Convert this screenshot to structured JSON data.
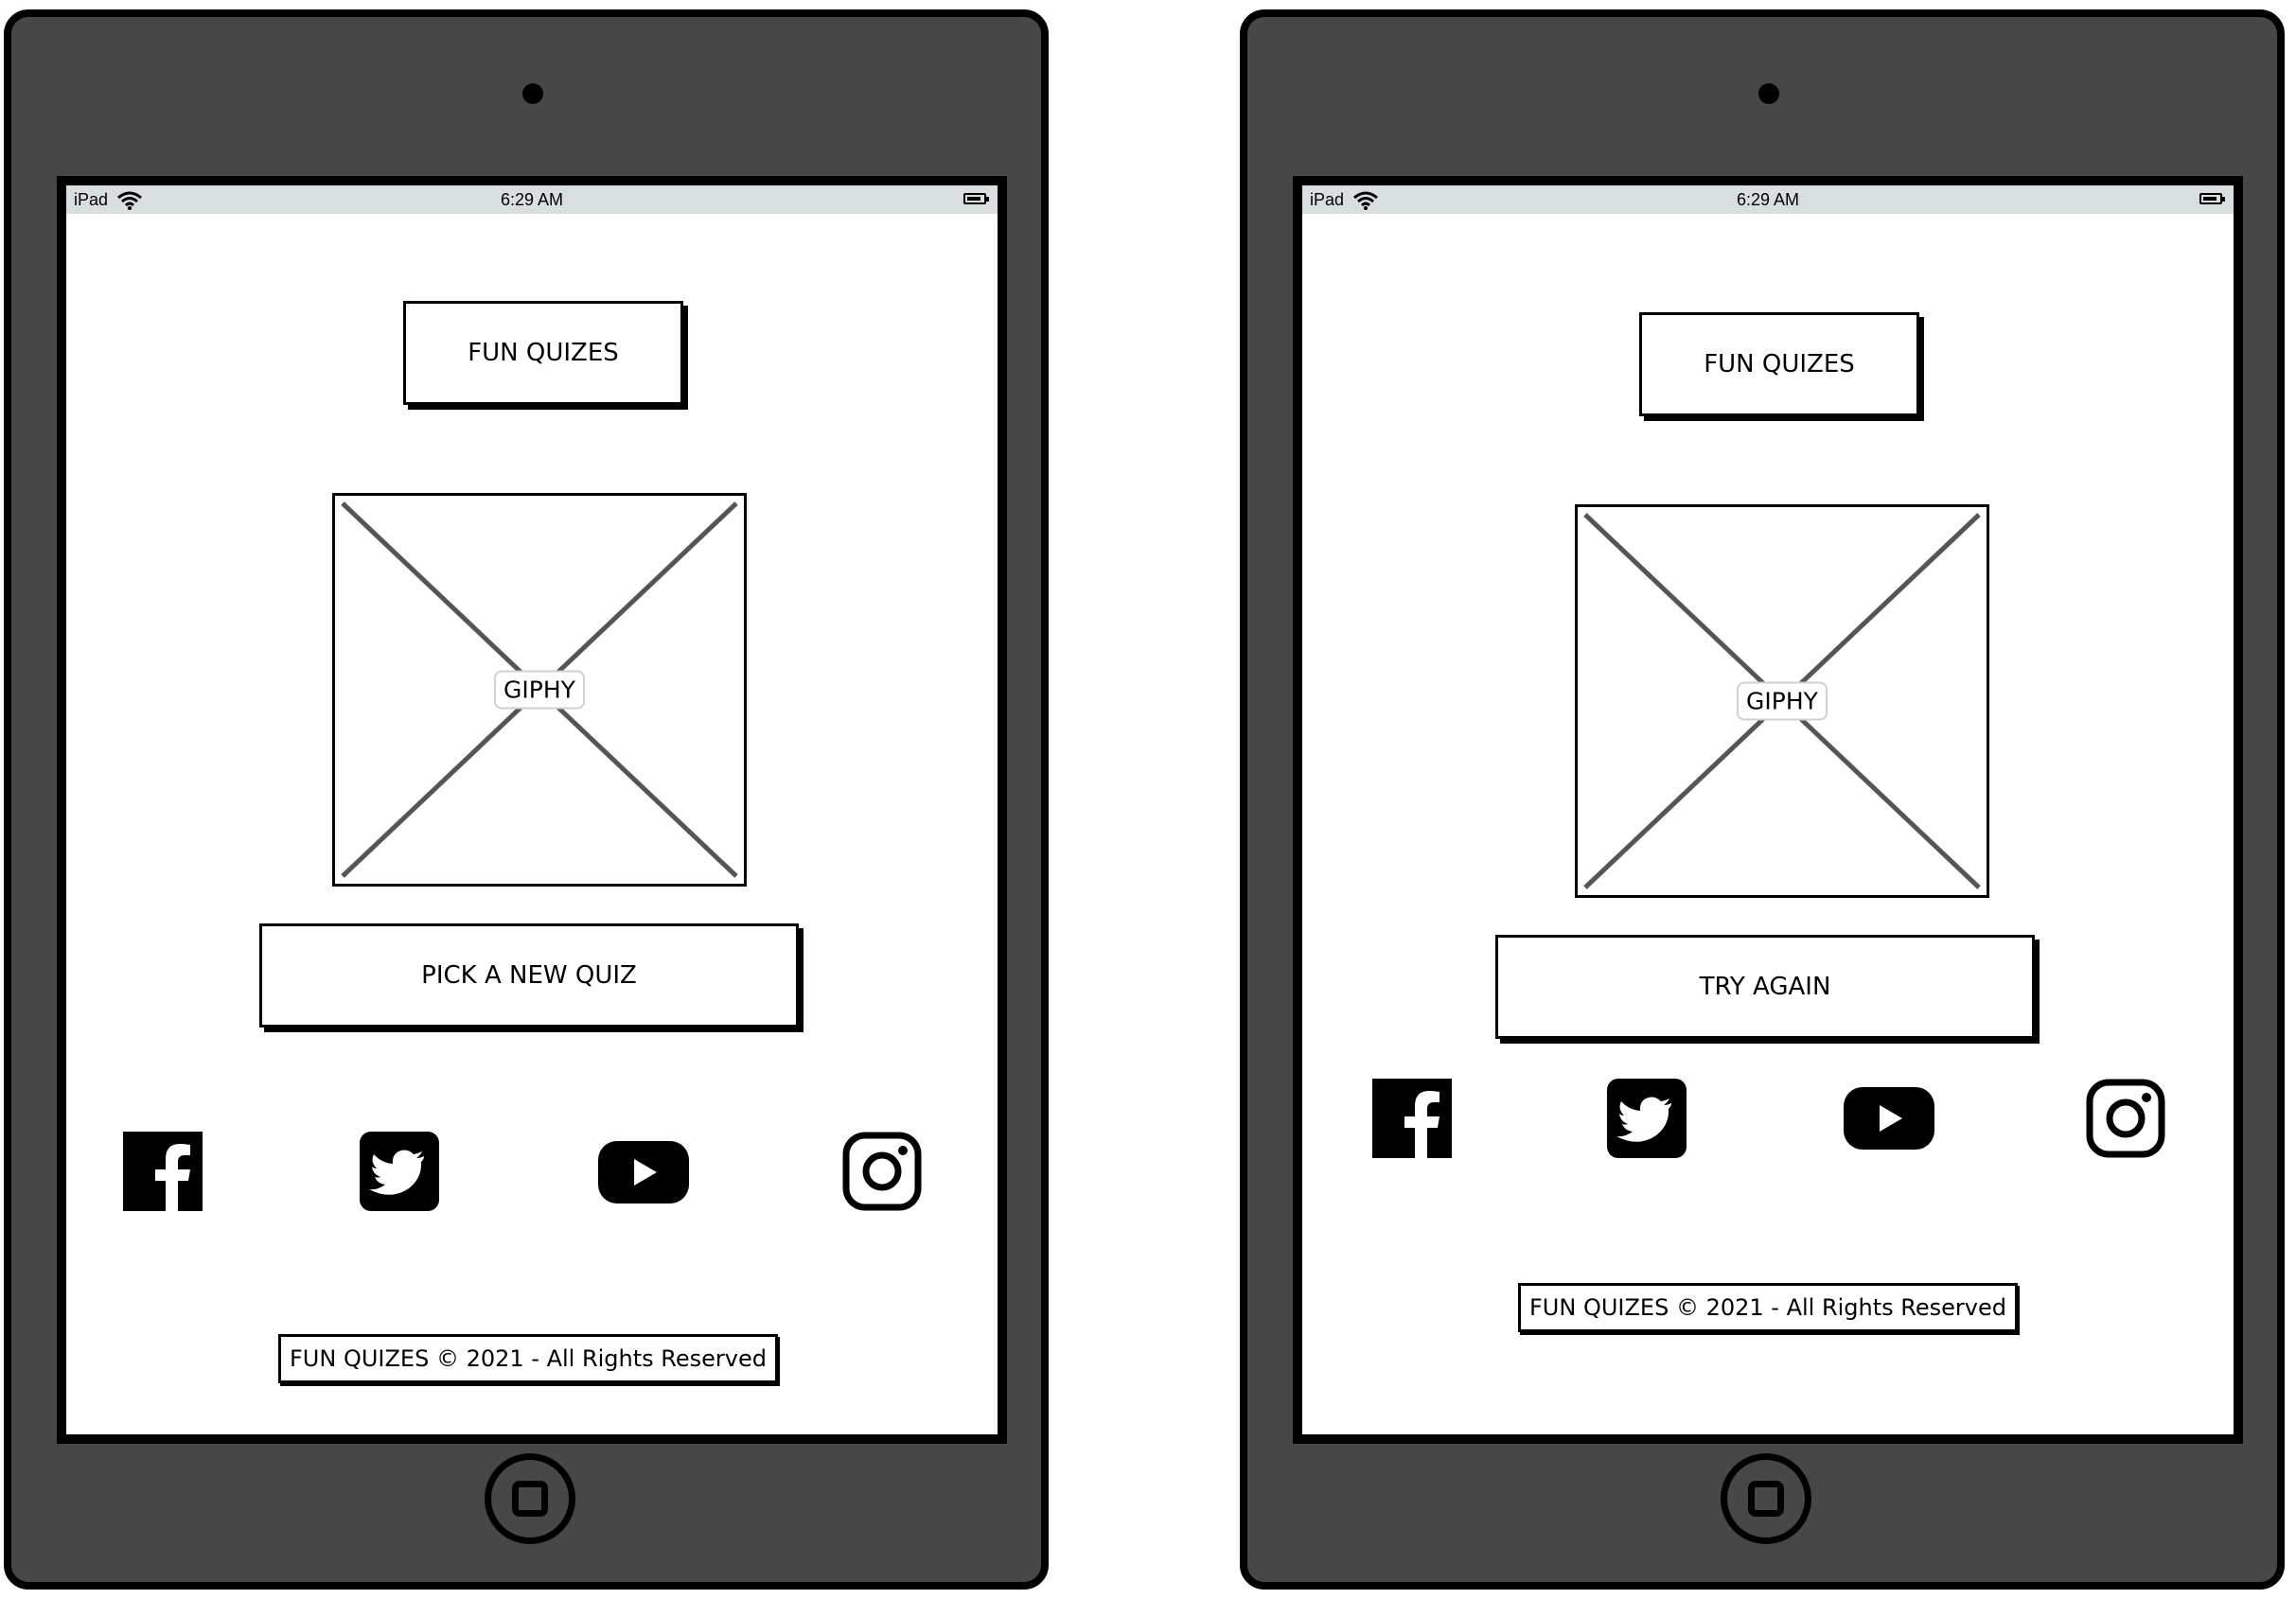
{
  "screens": [
    {
      "status": {
        "device": "iPad",
        "time": "6:29 AM"
      },
      "header_title": "FUN QUIZES",
      "image_label": "GIPHY",
      "action_button": "PICK A NEW QUIZ",
      "social_icons": [
        "facebook-icon",
        "twitter-icon",
        "youtube-icon",
        "instagram-icon"
      ],
      "footer": "FUN QUIZES © 2021 - All Rights Reserved"
    },
    {
      "status": {
        "device": "iPad",
        "time": "6:29 AM"
      },
      "header_title": "FUN QUIZES",
      "image_label": "GIPHY",
      "action_button": "TRY AGAIN",
      "social_icons": [
        "facebook-icon",
        "twitter-icon",
        "youtube-icon",
        "instagram-icon"
      ],
      "footer": "FUN QUIZES © 2021 - All Rights Reserved"
    }
  ]
}
